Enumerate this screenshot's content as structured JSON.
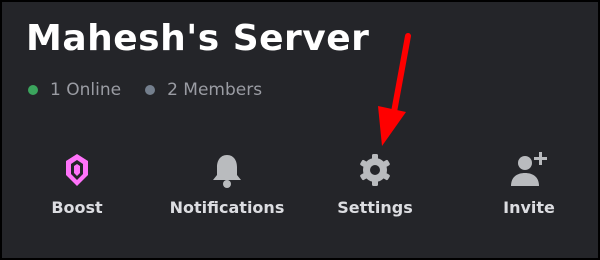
{
  "server": {
    "name": "Mahesh's Server",
    "online_count": "1 Online",
    "members_count": "2 Members"
  },
  "actions": [
    {
      "label": "Boost",
      "icon": "boost-gem-icon"
    },
    {
      "label": "Notifications",
      "icon": "bell-icon"
    },
    {
      "label": "Settings",
      "icon": "gear-icon"
    },
    {
      "label": "Invite",
      "icon": "add-user-icon"
    }
  ],
  "colors": {
    "background": "#242529",
    "text_primary": "#ffffff",
    "text_muted": "#9a9ca3",
    "online_dot": "#3ba55d",
    "members_dot": "#747f8d",
    "boost_pink": "#ff73fa",
    "icon_gray": "#b9bbbe",
    "annotation_arrow": "#ff0000"
  }
}
